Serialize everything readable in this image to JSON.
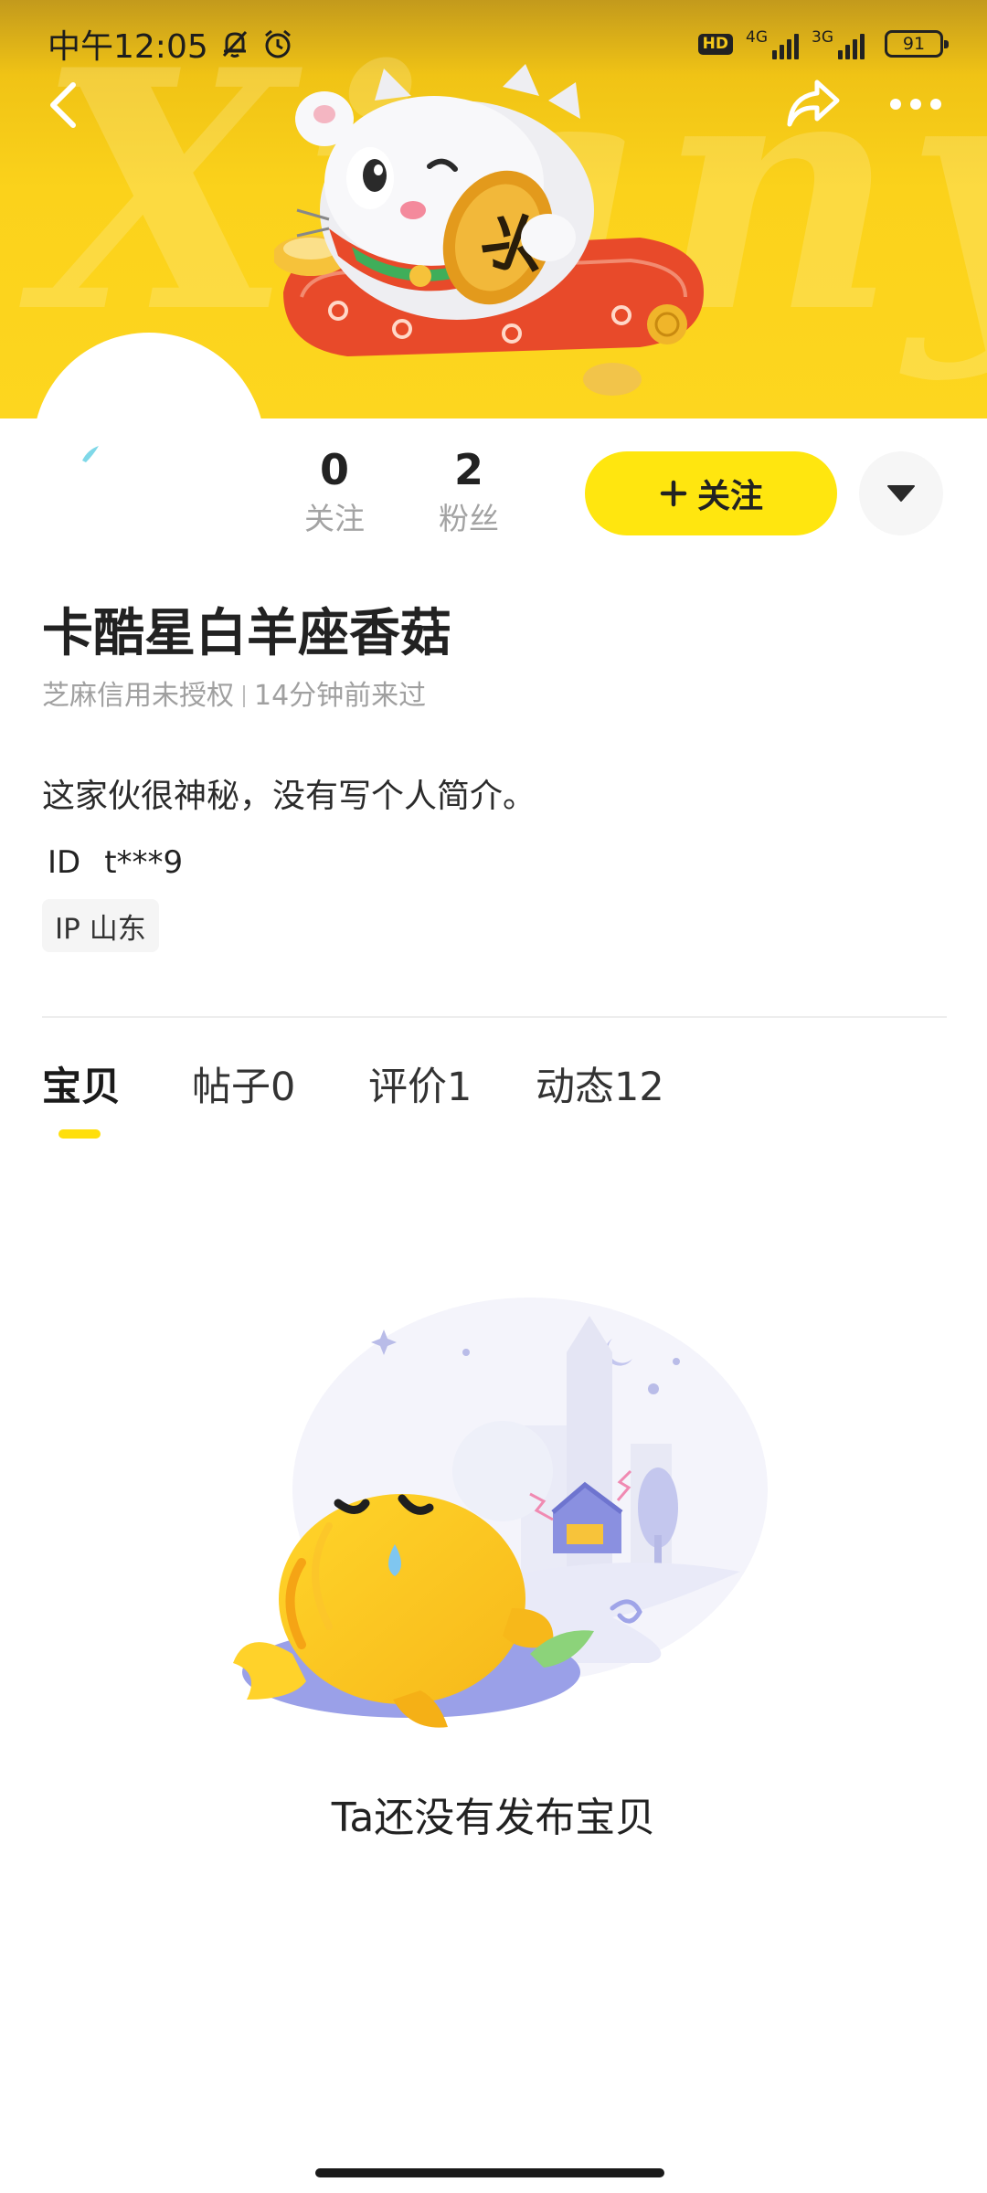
{
  "status_bar": {
    "time": "中午12:05",
    "network_1": "4G",
    "network_2": "3G",
    "battery": "91"
  },
  "profile": {
    "nickname": "卡酷星白羊座香菇",
    "credit": "芝麻信用未授权",
    "last_seen": "14分钟前来过",
    "bio": "这家伙很神秘，没有写个人简介。",
    "id_label": "ID",
    "id_value": "t***9",
    "ip_label": "IP 山东"
  },
  "stats": {
    "following_count": "0",
    "following_label": "关注",
    "fans_count": "2",
    "fans_label": "粉丝"
  },
  "actions": {
    "follow_label": "关注"
  },
  "tabs": [
    {
      "label": "宝贝",
      "active": true
    },
    {
      "label": "帖子0",
      "active": false
    },
    {
      "label": "评价1",
      "active": false
    },
    {
      "label": "动态12",
      "active": false
    }
  ],
  "empty_state": {
    "message": "Ta还没有发布宝贝"
  },
  "colors": {
    "accent_yellow": "#ffe60f",
    "banner_yellow": "#fdd61f"
  },
  "icons": [
    "bell-muted-icon",
    "alarm-icon",
    "back-icon",
    "share-icon",
    "more-icon",
    "plus-icon",
    "caret-down-icon"
  ]
}
